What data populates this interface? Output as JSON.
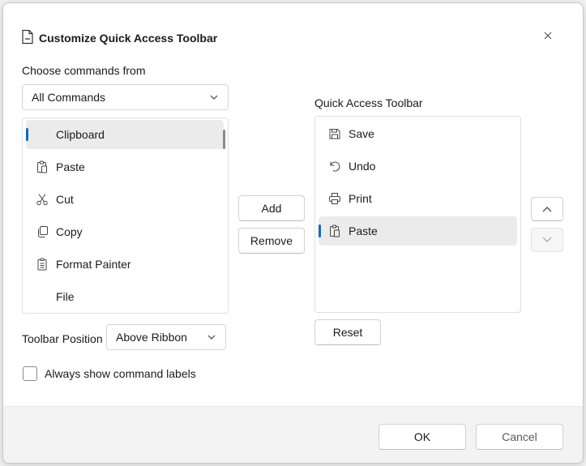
{
  "dialog": {
    "title": "Customize Quick Access Toolbar",
    "close_icon": "close-icon"
  },
  "commands": {
    "label": "Choose commands from",
    "source_selected": "All Commands",
    "items": [
      {
        "label": "Clipboard",
        "icon": "",
        "selected": true
      },
      {
        "label": "Paste",
        "icon": "paste-icon"
      },
      {
        "label": "Cut",
        "icon": "scissors-icon"
      },
      {
        "label": "Copy",
        "icon": "copy-icon"
      },
      {
        "label": "Format Painter",
        "icon": "format-painter-icon"
      },
      {
        "label": "File",
        "icon": ""
      }
    ]
  },
  "actions": {
    "add_label": "Add",
    "remove_label": "Remove"
  },
  "toolbar": {
    "label": "Quick Access Toolbar",
    "items": [
      {
        "label": "Save",
        "icon": "save-icon"
      },
      {
        "label": "Undo",
        "icon": "undo-icon"
      },
      {
        "label": "Print",
        "icon": "print-icon"
      },
      {
        "label": "Paste",
        "icon": "paste-icon",
        "selected": true
      }
    ],
    "reset_label": "Reset"
  },
  "position": {
    "label": "Toolbar Position",
    "selected": "Above Ribbon"
  },
  "labels_checkbox": {
    "label": "Always show command labels",
    "checked": false
  },
  "footer": {
    "ok_label": "OK",
    "cancel_label": "Cancel"
  },
  "colors": {
    "accent": "#0f6cbd",
    "selected_row": "#ebebeb"
  }
}
